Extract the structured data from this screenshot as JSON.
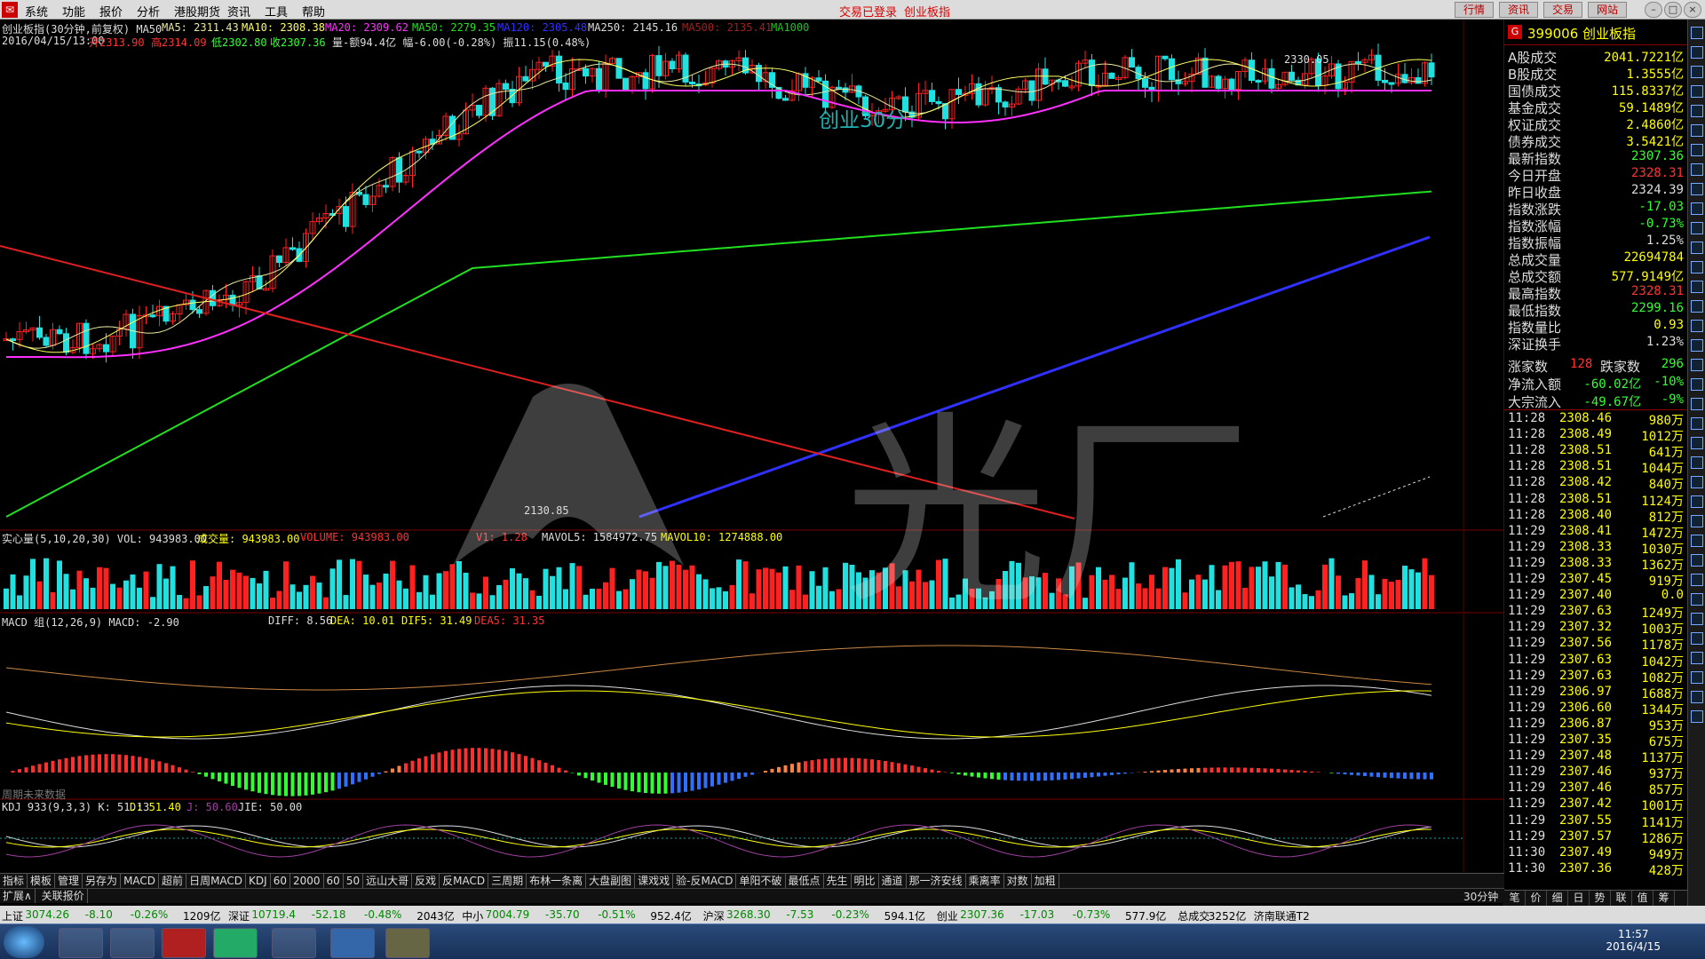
{
  "menubar": {
    "items": [
      "系统",
      "功能",
      "报价",
      "分析",
      "港股期货",
      "资讯",
      "工具",
      "帮助"
    ],
    "status_login": "交易已登录",
    "status_board": "创业板指",
    "tabs": [
      "行情",
      "资讯",
      "交易",
      "网站"
    ]
  },
  "chart_header": {
    "title": "创业板指(30分钟,前复权) MA50",
    "ma5": "MA5: 2311.43",
    "ma10": "MA10: 2308.38",
    "ma20": "MA20: 2309.62",
    "ma50": "MA50: 2279.35",
    "ma120": "MA120: 2305.48",
    "ma250": "MA250: 2145.16",
    "ma500": "MA500: 2135.41",
    "ma1000": "MA1000",
    "line2_date": "2016/04/15/13:00",
    "line2_open": "开2313.90",
    "line2_high": "高2314.09",
    "line2_low": "低2302.80",
    "line2_close": "收2307.36",
    "line2_rest": "量-额94.4亿 幅-6.00(-0.28%) 振11.15(0.48%)",
    "overlay_text": "创业30分",
    "peak_label": "2330.05",
    "low_label": "2130.85"
  },
  "vol_header": {
    "title": "实心量(5,10,20,30) VOL: 943983.00",
    "vol": "成交量: 943983.00",
    "volume": "VOLUME: 943983.00",
    "v1": "V1: 1.28",
    "mavol5": "MAVOL5: 1584972.75",
    "mavol10": "MAVOL10: 1274888.00"
  },
  "macd_header": {
    "title": "MACD 组(12,26,9) MACD: -2.90",
    "diff": "DIFF: 8.56",
    "dea": "DEA: 10.01",
    "dif5": "DIF5: 31.49",
    "dea5": "DEA5: 31.35",
    "footer": "周期未来数据"
  },
  "kdj_header": {
    "title": "KDJ 933(9,3,3) K: 51.13",
    "d": "D: 51.40",
    "j": "J: 50.60",
    "jie": "JIE: 50.00"
  },
  "right_panel": {
    "code_title": "399006 创业板指",
    "rows": [
      {
        "k": "A股成交",
        "v": "2041.7221亿",
        "c": "#ff0"
      },
      {
        "k": "B股成交",
        "v": "1.3555亿",
        "c": "#ff0"
      },
      {
        "k": "国债成交",
        "v": "115.8337亿",
        "c": "#ff0"
      },
      {
        "k": "基金成交",
        "v": "59.1489亿",
        "c": "#ff0"
      },
      {
        "k": "权证成交",
        "v": "2.4860亿",
        "c": "#ff0"
      },
      {
        "k": "债券成交",
        "v": "3.5421亿",
        "c": "#ff0"
      },
      {
        "k": "最新指数",
        "v": "2307.36",
        "c": "#3f3"
      },
      {
        "k": "今日开盘",
        "v": "2328.31",
        "c": "#f33"
      },
      {
        "k": "昨日收盘",
        "v": "2324.39",
        "c": "#ddd"
      },
      {
        "k": "指数涨跌",
        "v": "-17.03",
        "c": "#3f3"
      },
      {
        "k": "指数涨幅",
        "v": "-0.73%",
        "c": "#3f3"
      },
      {
        "k": "指数振幅",
        "v": "1.25%",
        "c": "#ddd"
      },
      {
        "k": "总成交量",
        "v": "22694784",
        "c": "#ff0"
      },
      {
        "k": "总成交额",
        "v": "577.9149亿",
        "c": "#ff0"
      },
      {
        "k": "最高指数",
        "v": "2328.31",
        "c": "#f33"
      },
      {
        "k": "最低指数",
        "v": "2299.16",
        "c": "#3f3"
      },
      {
        "k": "指数量比",
        "v": "0.93",
        "c": "#ff0"
      },
      {
        "k": "深证换手",
        "v": "1.23%",
        "c": "#ddd"
      }
    ],
    "up_label": "涨家数",
    "up_value": "128",
    "down_label": "跌家数",
    "down_value": "296",
    "net_inflow_label": "净流入额",
    "net_inflow_value": "-60.02亿",
    "net_inflow_pct": "-10%",
    "block_label": "大宗流入",
    "block_value": "-49.67亿",
    "block_pct": "-9%"
  },
  "ticks": [
    [
      "11:28",
      "2308.46",
      "980万"
    ],
    [
      "11:28",
      "2308.49",
      "1012万"
    ],
    [
      "11:28",
      "2308.51",
      "641万"
    ],
    [
      "11:28",
      "2308.51",
      "1044万"
    ],
    [
      "11:28",
      "2308.42",
      "840万"
    ],
    [
      "11:28",
      "2308.51",
      "1124万"
    ],
    [
      "11:28",
      "2308.40",
      "812万"
    ],
    [
      "11:29",
      "2308.41",
      "1472万"
    ],
    [
      "11:29",
      "2308.33",
      "1030万"
    ],
    [
      "11:29",
      "2308.33",
      "1362万"
    ],
    [
      "11:29",
      "2307.45",
      "919万"
    ],
    [
      "11:29",
      "2307.40",
      "0.0"
    ],
    [
      "11:29",
      "2307.63",
      "1249万"
    ],
    [
      "11:29",
      "2307.32",
      "1003万"
    ],
    [
      "11:29",
      "2307.56",
      "1178万"
    ],
    [
      "11:29",
      "2307.63",
      "1042万"
    ],
    [
      "11:29",
      "2307.63",
      "1082万"
    ],
    [
      "11:29",
      "2306.97",
      "1688万"
    ],
    [
      "11:29",
      "2306.60",
      "1344万"
    ],
    [
      "11:29",
      "2306.87",
      "953万"
    ],
    [
      "11:29",
      "2307.35",
      "675万"
    ],
    [
      "11:29",
      "2307.48",
      "1137万"
    ],
    [
      "11:29",
      "2307.46",
      "937万"
    ],
    [
      "11:29",
      "2307.46",
      "857万"
    ],
    [
      "11:29",
      "2307.42",
      "1001万"
    ],
    [
      "11:29",
      "2307.55",
      "1141万"
    ],
    [
      "11:29",
      "2307.57",
      "1286万"
    ],
    [
      "11:30",
      "2307.49",
      "949万"
    ],
    [
      "11:30",
      "2307.36",
      "428万"
    ]
  ],
  "bottom_tabs": [
    "指标",
    "模板",
    "管理",
    "另存为",
    "MACD",
    "超前",
    "日周MACD",
    "KDJ",
    "60",
    "2000",
    "60",
    "50",
    "远山大哥",
    "反戏",
    "反MACD",
    "三周期",
    "布林一条离",
    "大盘副图",
    "课戏戏",
    "验-反MACD",
    "单阳不破",
    "最低点",
    "先生",
    "明比",
    "通道",
    "那一济安线",
    "乘离率",
    "对数",
    "加粗"
  ],
  "bottom_tabs2": [
    "扩展∧",
    "关联报价"
  ],
  "period_label": "30分钟",
  "right_tabs": [
    "笔",
    "价",
    "细",
    "日",
    "势",
    "联",
    "值",
    "筹"
  ],
  "status": [
    {
      "t": "上证",
      "c": "#000"
    },
    {
      "t": "3074.26",
      "c": "#080"
    },
    {
      "t": "-8.10",
      "c": "#080"
    },
    {
      "t": "-0.26%",
      "c": "#080"
    },
    {
      "t": "1209亿",
      "c": "#000"
    },
    {
      "t": "深证",
      "c": "#000"
    },
    {
      "t": "10719.4",
      "c": "#080"
    },
    {
      "t": "-52.18",
      "c": "#080"
    },
    {
      "t": "-0.48%",
      "c": "#080"
    },
    {
      "t": "2043亿",
      "c": "#000"
    },
    {
      "t": "中小",
      "c": "#000"
    },
    {
      "t": "7004.79",
      "c": "#080"
    },
    {
      "t": "-35.70",
      "c": "#080"
    },
    {
      "t": "-0.51%",
      "c": "#080"
    },
    {
      "t": "952.4亿",
      "c": "#000"
    },
    {
      "t": "沪深",
      "c": "#000"
    },
    {
      "t": "3268.30",
      "c": "#080"
    },
    {
      "t": "-7.53",
      "c": "#080"
    },
    {
      "t": "-0.23%",
      "c": "#080"
    },
    {
      "t": "594.1亿",
      "c": "#000"
    },
    {
      "t": "创业",
      "c": "#000"
    },
    {
      "t": "2307.36",
      "c": "#080"
    },
    {
      "t": "-17.03",
      "c": "#080"
    },
    {
      "t": "-0.73%",
      "c": "#080"
    },
    {
      "t": "577.9亿",
      "c": "#000"
    },
    {
      "t": "总成交",
      "c": "#000"
    },
    {
      "t": "3252亿",
      "c": "#000"
    },
    {
      "t": "济南联通T2",
      "c": "#000"
    }
  ],
  "clock": {
    "time": "11:57",
    "date": "2016/4/15"
  },
  "colors": {
    "up": "#ff2020",
    "down": "#20e0e0",
    "ma5": "#e8e8a0",
    "ma10": "#ffff60",
    "ma20": "#ff30ff",
    "ma50": "#20e020",
    "ma120": "#3030ff",
    "trend": "#e02020"
  }
}
